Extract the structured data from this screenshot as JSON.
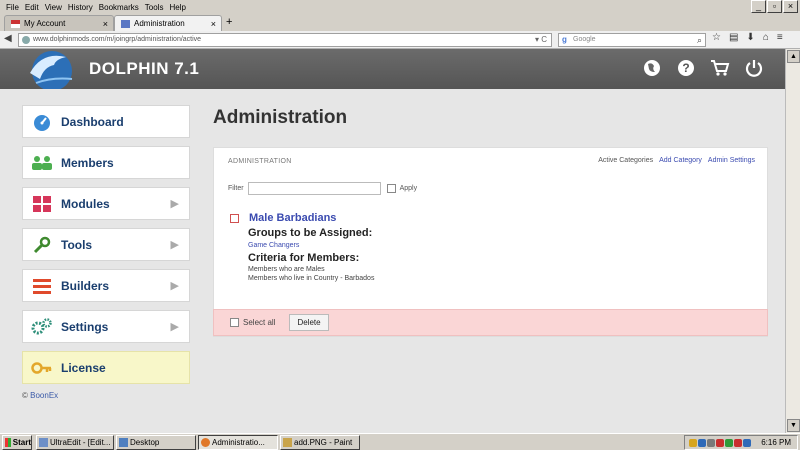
{
  "browser": {
    "menu": [
      "File",
      "Edit",
      "View",
      "History",
      "Bookmarks",
      "Tools",
      "Help"
    ],
    "tabs": [
      {
        "label": "My Account"
      },
      {
        "label": "Administration"
      }
    ],
    "url": "www.dolphinmods.com/m/joingrp/administration/active",
    "search_placeholder": "Google"
  },
  "app": {
    "title": "DOLPHIN 7.1"
  },
  "sidebar": {
    "items": [
      {
        "label": "Dashboard",
        "icon": "dashboard-icon"
      },
      {
        "label": "Members",
        "icon": "members-icon"
      },
      {
        "label": "Modules",
        "icon": "modules-icon"
      },
      {
        "label": "Tools",
        "icon": "wrench-icon"
      },
      {
        "label": "Builders",
        "icon": "builders-icon"
      },
      {
        "label": "Settings",
        "icon": "gears-icon"
      },
      {
        "label": "License",
        "icon": "key-icon"
      }
    ],
    "copyright_symbol": "©",
    "copyright_name": "BoonEx"
  },
  "main": {
    "title": "Administration",
    "panel": {
      "heading": "ADMINISTRATION",
      "links": {
        "active": "Active Categories",
        "add": "Add Category",
        "settings": "Admin Settings"
      },
      "filter_label": "Filter",
      "apply_label": "Apply",
      "entry": {
        "name": "Male Barbadians",
        "groups_heading": "Groups to be Assigned:",
        "group": "Game Changers",
        "criteria_heading": "Criteria for Members:",
        "criteria": [
          "Members who are Males",
          "Members who live in Country - Barbados"
        ]
      },
      "select_all": "Select all",
      "delete": "Delete"
    }
  },
  "taskbar": {
    "start": "Start",
    "tasks": [
      {
        "label": "UltraEdit - [Edit..."
      },
      {
        "label": "Desktop"
      },
      {
        "label": "Administratio..."
      },
      {
        "label": "add.PNG - Paint"
      }
    ],
    "clock": "6:16 PM"
  }
}
